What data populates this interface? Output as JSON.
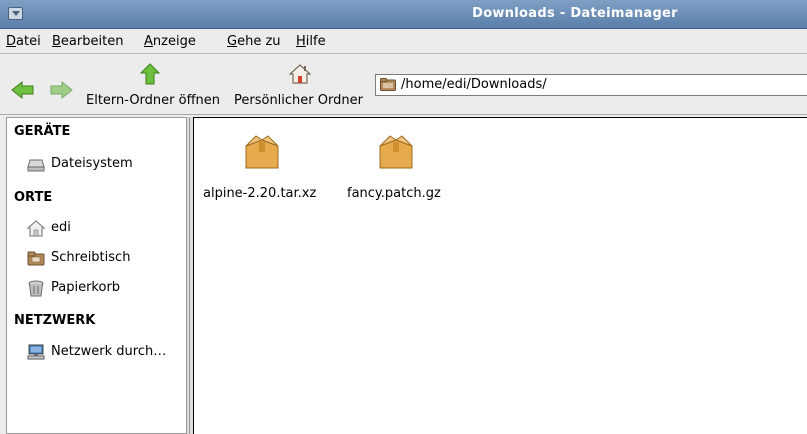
{
  "window": {
    "title": "Downloads - Dateimanager"
  },
  "menubar": {
    "items": [
      {
        "label": "Datei",
        "mnemonic": "D",
        "rest": "atei"
      },
      {
        "label": "Bearbeiten",
        "mnemonic": "B",
        "rest": "earbeiten"
      },
      {
        "label": "Anzeige",
        "mnemonic": "A",
        "rest": "nzeige"
      },
      {
        "label": "Gehe zu",
        "mnemonic": "G",
        "rest": "ehe zu"
      },
      {
        "label": "Hilfe",
        "mnemonic": "H",
        "rest": "ilfe"
      }
    ]
  },
  "toolbar": {
    "back_icon": "back-arrow-icon",
    "forward_icon": "forward-arrow-icon",
    "parent_label": "Eltern-Ordner öffnen",
    "home_label": "Persönlicher Ordner",
    "path": "/home/edi/Downloads/"
  },
  "sidebar": {
    "sections": [
      {
        "header": "GERÄTE",
        "items": [
          {
            "label": "Dateisystem",
            "icon": "drive-icon"
          }
        ]
      },
      {
        "header": "ORTE",
        "items": [
          {
            "label": "edi",
            "icon": "home-icon"
          },
          {
            "label": "Schreibtisch",
            "icon": "desktop-folder-icon"
          },
          {
            "label": "Papierkorb",
            "icon": "trash-icon"
          }
        ]
      },
      {
        "header": "NETZWERK",
        "items": [
          {
            "label": "Netzwerk durch…",
            "icon": "network-icon"
          }
        ]
      }
    ]
  },
  "files": [
    {
      "name": "alpine-2.20.tar.xz",
      "icon": "package-icon"
    },
    {
      "name": "fancy.patch.gz",
      "icon": "package-icon"
    }
  ],
  "colors": {
    "titlebar": "#5b7fab",
    "arrow_green": "#5fb336",
    "package": "#e6a94c"
  }
}
